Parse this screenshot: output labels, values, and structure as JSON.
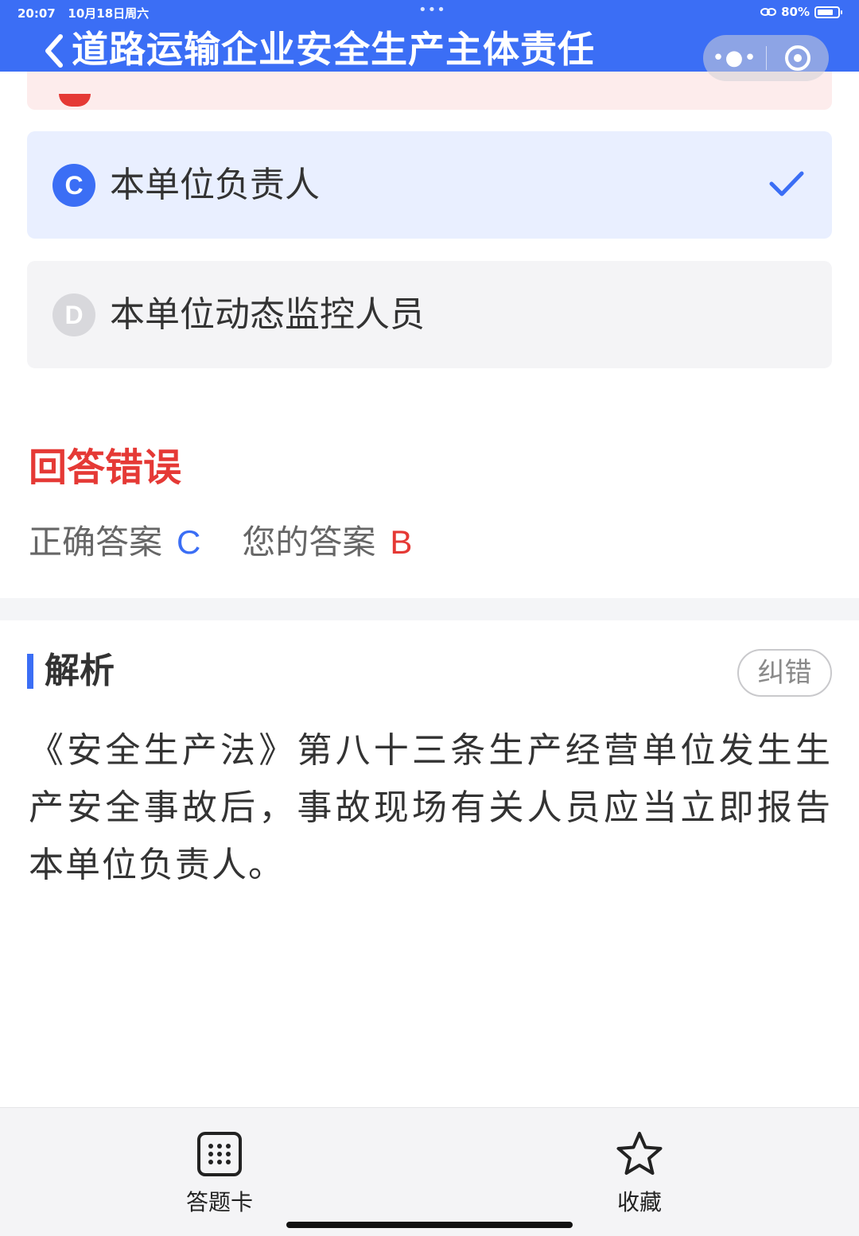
{
  "status_bar": {
    "time": "20:07",
    "date": "10月18日周六",
    "dots": "•••",
    "battery": "80%",
    "battery_fraction": 0.8
  },
  "header": {
    "title": "道路运输企业安全生产主体责任",
    "background_color": "#3b6ef5",
    "back_icon": "back-icon",
    "capsule_more_icon": "more-dots-icon",
    "capsule_close_icon": "target-close-icon"
  },
  "options": [
    {
      "letter": "C",
      "text": "本单位负责人",
      "state": "correct",
      "mark_icon": "check-icon"
    },
    {
      "letter": "D",
      "text": "本单位动态监控人员",
      "state": "neutral"
    }
  ],
  "result": {
    "title": "回答错误",
    "correct_label": "正确答案",
    "correct_value": "C",
    "your_label": "您的答案",
    "your_value": "B"
  },
  "analysis": {
    "title": "解析",
    "correction_button": "纠错",
    "text": "《安全生产法》第八十三条生产经营单位发生生产安全事故后，事故现场有关人员应当立即报告本单位负责人。"
  },
  "bottom_bar": {
    "answer_card_label": "答题卡",
    "answer_card_icon": "grid-icon",
    "favorite_label": "收藏",
    "favorite_icon": "star-icon"
  },
  "colors": {
    "accent": "#3b6ef5",
    "error": "#e53935",
    "correct_bg": "#e9efff",
    "wrong_bg": "#fdecec"
  }
}
